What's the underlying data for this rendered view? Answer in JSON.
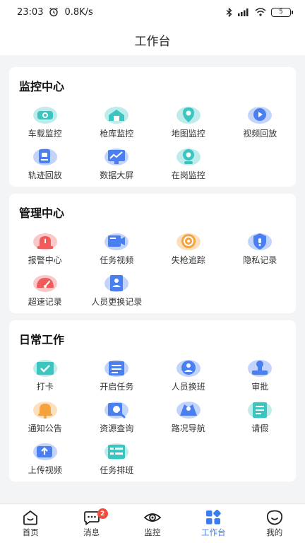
{
  "status_bar": {
    "time": "23:03",
    "speed": "0.8K/s",
    "battery": "5"
  },
  "header": {
    "title": "工作台"
  },
  "sections": [
    {
      "title": "监控中心",
      "items": [
        {
          "label": "车载监控",
          "icon": "car-camera-icon",
          "color": "#3cc5c0"
        },
        {
          "label": "枪库监控",
          "icon": "armory-icon",
          "color": "#3cc5c0"
        },
        {
          "label": "地图监控",
          "icon": "map-pin-icon",
          "color": "#3cc5c0"
        },
        {
          "label": "视频回放",
          "icon": "video-replay-icon",
          "color": "#4a7ff2"
        },
        {
          "label": "轨迹回放",
          "icon": "track-replay-icon",
          "color": "#4a7ff2"
        },
        {
          "label": "数据大屏",
          "icon": "data-screen-icon",
          "color": "#4a7ff2"
        },
        {
          "label": "在岗监控",
          "icon": "webcam-icon",
          "color": "#3cc5c0"
        }
      ]
    },
    {
      "title": "管理中心",
      "items": [
        {
          "label": "报警中心",
          "icon": "alarm-icon",
          "color": "#f05a5a"
        },
        {
          "label": "任务视频",
          "icon": "task-video-icon",
          "color": "#4a7ff2"
        },
        {
          "label": "失枪追踪",
          "icon": "tracking-icon",
          "color": "#f5a23c"
        },
        {
          "label": "隐私记录",
          "icon": "shield-icon",
          "color": "#4a7ff2"
        },
        {
          "label": "超速记录",
          "icon": "speedometer-icon",
          "color": "#f05a5a"
        },
        {
          "label": "人员更换记录",
          "icon": "person-doc-icon",
          "color": "#4a7ff2"
        }
      ]
    },
    {
      "title": "日常工作",
      "items": [
        {
          "label": "打卡",
          "icon": "check-in-icon",
          "color": "#3cc5c0"
        },
        {
          "label": "开启任务",
          "icon": "start-task-icon",
          "color": "#4a7ff2"
        },
        {
          "label": "人员换班",
          "icon": "shift-change-icon",
          "color": "#4a7ff2"
        },
        {
          "label": "审批",
          "icon": "stamp-icon",
          "color": "#4a7ff2"
        },
        {
          "label": "通知公告",
          "icon": "bell-icon",
          "color": "#f5a23c"
        },
        {
          "label": "资源查询",
          "icon": "search-icon",
          "color": "#4a7ff2"
        },
        {
          "label": "路况导航",
          "icon": "navigation-icon",
          "color": "#4a7ff2"
        },
        {
          "label": "请假",
          "icon": "leave-form-icon",
          "color": "#3cc5c0"
        },
        {
          "label": "上传视频",
          "icon": "upload-icon",
          "color": "#4a7ff2"
        },
        {
          "label": "任务排班",
          "icon": "schedule-icon",
          "color": "#3cc5c0"
        }
      ]
    }
  ],
  "bottom_nav": [
    {
      "label": "首页",
      "icon": "home-icon"
    },
    {
      "label": "消息",
      "icon": "chat-icon",
      "badge": "2"
    },
    {
      "label": "监控",
      "icon": "eye-icon"
    },
    {
      "label": "工作台",
      "icon": "workbench-icon",
      "active": true
    },
    {
      "label": "我的",
      "icon": "profile-icon"
    }
  ],
  "accent_color": "#3b7df0"
}
